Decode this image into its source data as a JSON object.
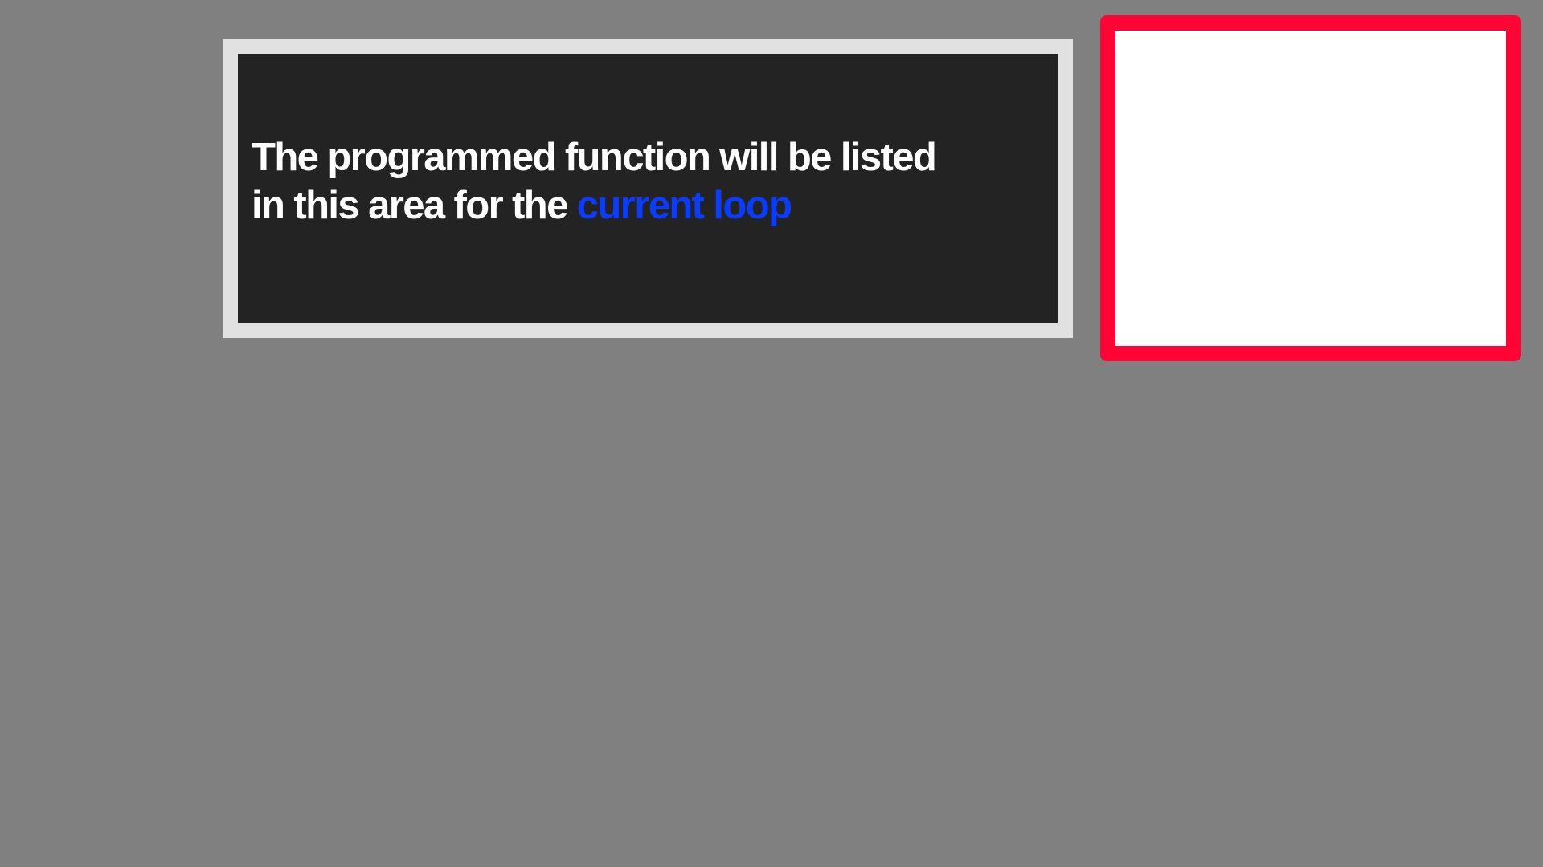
{
  "info_panel": {
    "line1": "The programmed function will be listed",
    "line2_prefix": "in this area for the ",
    "line2_highlight": "current loop"
  },
  "colors": {
    "background": "#808080",
    "panel_frame": "#e1e1e1",
    "panel_fill": "#232323",
    "text": "#ffffff",
    "highlight": "#0a3cff",
    "preview_border": "#ff0535",
    "preview_fill": "#ffffff"
  }
}
